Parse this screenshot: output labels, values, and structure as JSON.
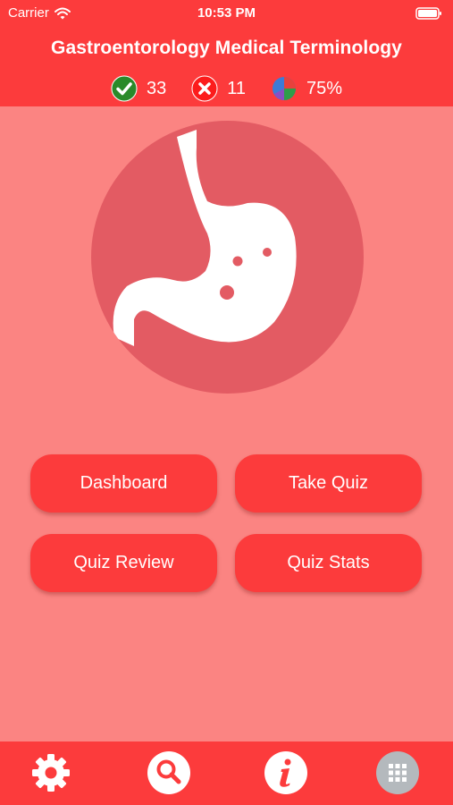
{
  "status_bar": {
    "carrier": "Carrier",
    "time": "10:53 PM"
  },
  "header": {
    "title": "Gastroentorology Medical Terminology",
    "stats": {
      "correct": "33",
      "incorrect": "11",
      "score": "75%"
    }
  },
  "hero": {
    "icon": "stomach-icon"
  },
  "buttons": {
    "dashboard": "Dashboard",
    "take_quiz": "Take Quiz",
    "quiz_review": "Quiz Review",
    "quiz_stats": "Quiz Stats"
  },
  "tabbar": {
    "items": [
      "gear-icon",
      "search-icon",
      "info-icon",
      "grid-icon"
    ]
  },
  "colors": {
    "header_bg": "#fc3b3c",
    "page_bg": "#fb8482",
    "hero_circle": "#e35b63",
    "correct_green": "#2a8a2a",
    "incorrect_red": "#fc1c1c",
    "text": "#ffffff"
  }
}
